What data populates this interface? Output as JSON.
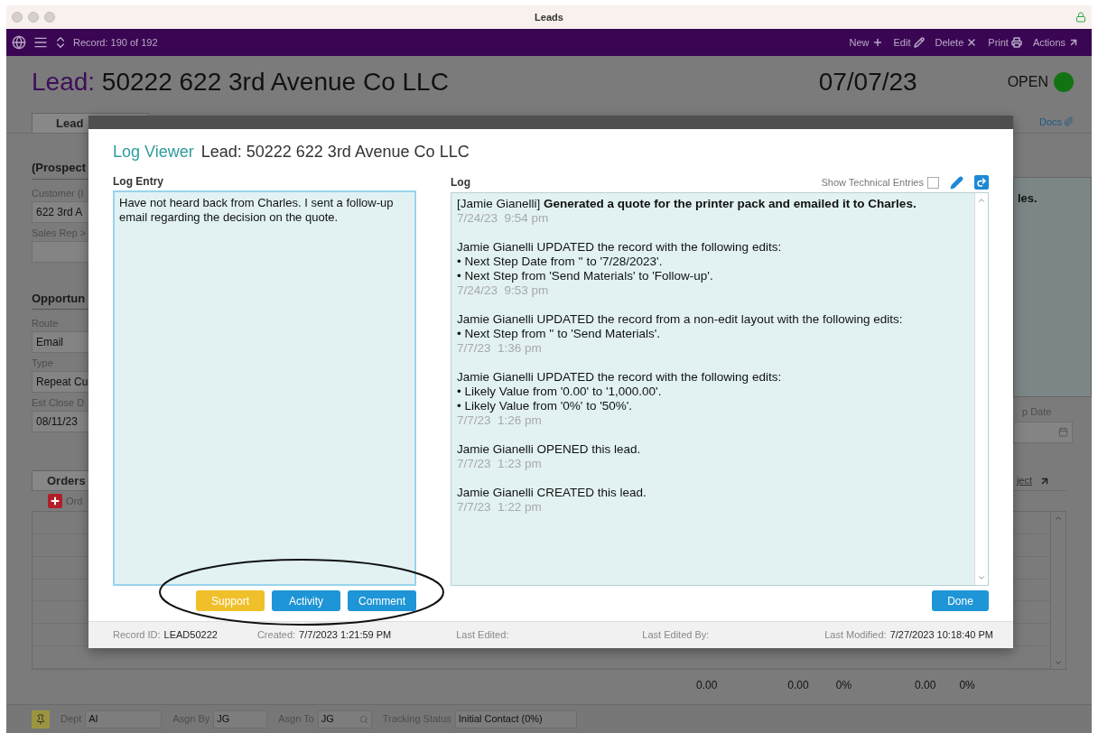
{
  "window": {
    "title": "Leads"
  },
  "toolbar": {
    "record": "Record: 190 of 192",
    "actions": [
      {
        "label": "New",
        "kind": "new"
      },
      {
        "label": "Edit",
        "kind": "edit"
      },
      {
        "label": "Delete",
        "kind": "delete"
      },
      {
        "label": "Print",
        "kind": "print"
      },
      {
        "label": "Actions",
        "kind": "actions"
      }
    ]
  },
  "header": {
    "prefix": "Lead:",
    "title": "50222 622 3rd Avenue Co LLC",
    "date": "07/07/23",
    "status": "OPEN"
  },
  "tabs": [
    {
      "label": "Lead",
      "selected": true
    }
  ],
  "docs_link": "Docs",
  "prospect": {
    "heading": "(Prospect",
    "fields": [
      {
        "label": "Customer (I",
        "value": "622 3rd A"
      },
      {
        "label": "Sales Rep >"
      }
    ]
  },
  "opportunity": {
    "heading": "Opportun",
    "fields": [
      {
        "label": "Route",
        "value": "Email"
      },
      {
        "label": "Type",
        "value": "Repeat Cu"
      },
      {
        "label": "Est Close D",
        "value": "08/11/23"
      }
    ]
  },
  "right_panel": {
    "note": "les.",
    "date_label": "p Date"
  },
  "orders": {
    "tab": "Orders",
    "add_label": "Ord",
    "link": "ject",
    "totals": [
      "0.00",
      "0.00",
      "0%",
      "0.00",
      "0%"
    ]
  },
  "bottom_bar": {
    "fields": [
      {
        "label": "Dept",
        "value": "AI"
      },
      {
        "label": "Asgn By",
        "value": "JG"
      },
      {
        "label": "Asgn To",
        "value": "JG",
        "search": true
      },
      {
        "label": "Tracking Status",
        "value": "Initial Contact (0%)"
      }
    ]
  },
  "log_viewer": {
    "title": "Log Viewer",
    "subtitle": "Lead: 50222 622 3rd Avenue Co LLC",
    "entry_label": "Log Entry",
    "entry_value": "Have not heard back from Charles. I sent a follow-up email regarding the decision on the quote.",
    "buttons": [
      {
        "label": "Support",
        "kind": "warning"
      },
      {
        "label": "Activity",
        "kind": "primary"
      },
      {
        "label": "Comment",
        "kind": "primary"
      }
    ],
    "log_label": "Log",
    "technical_label": "Show Technical Entries",
    "technical_checked": false,
    "entries": [
      {
        "lines": [
          "[Jamie Gianelli] **Generated a quote for the printer pack and emailed it to Charles.**"
        ],
        "time": "7/24/23  9:54 pm"
      },
      {
        "lines": [
          "Jamie Gianelli UPDATED the record with the following edits:",
          "• Next Step Date from '' to '7/28/2023'.",
          "• Next Step from 'Send Materials' to 'Follow-up'."
        ],
        "time": "7/24/23  9:53 pm"
      },
      {
        "lines": [
          "Jamie Gianelli UPDATED the record from a non-edit layout with the following edits:",
          "• Next Step from '' to 'Send Materials'."
        ],
        "time": "7/7/23  1:36 pm"
      },
      {
        "lines": [
          "Jamie Gianelli UPDATED the record with the following edits:",
          "• Likely Value from '0.00' to '1,000.00'.",
          "• Likely Value from '0%' to '50%'."
        ],
        "time": "7/7/23  1:26 pm"
      },
      {
        "lines": [
          "Jamie Gianelli OPENED this lead."
        ],
        "time": "7/7/23  1:23 pm"
      },
      {
        "lines": [
          "Jamie Gianelli CREATED this lead."
        ],
        "time": "7/7/23  1:22 pm"
      }
    ],
    "done": "Done",
    "footer": [
      {
        "label": "Record ID:",
        "value": "LEAD50222"
      },
      {
        "label": "Created:",
        "value": "7/7/2023 1:21:59 PM"
      },
      {
        "label": "Last Edited:"
      },
      {
        "label": "Last Edited By:"
      },
      {
        "label": "Last Modified:",
        "value": "7/27/2023 10:18:40 PM"
      }
    ]
  }
}
